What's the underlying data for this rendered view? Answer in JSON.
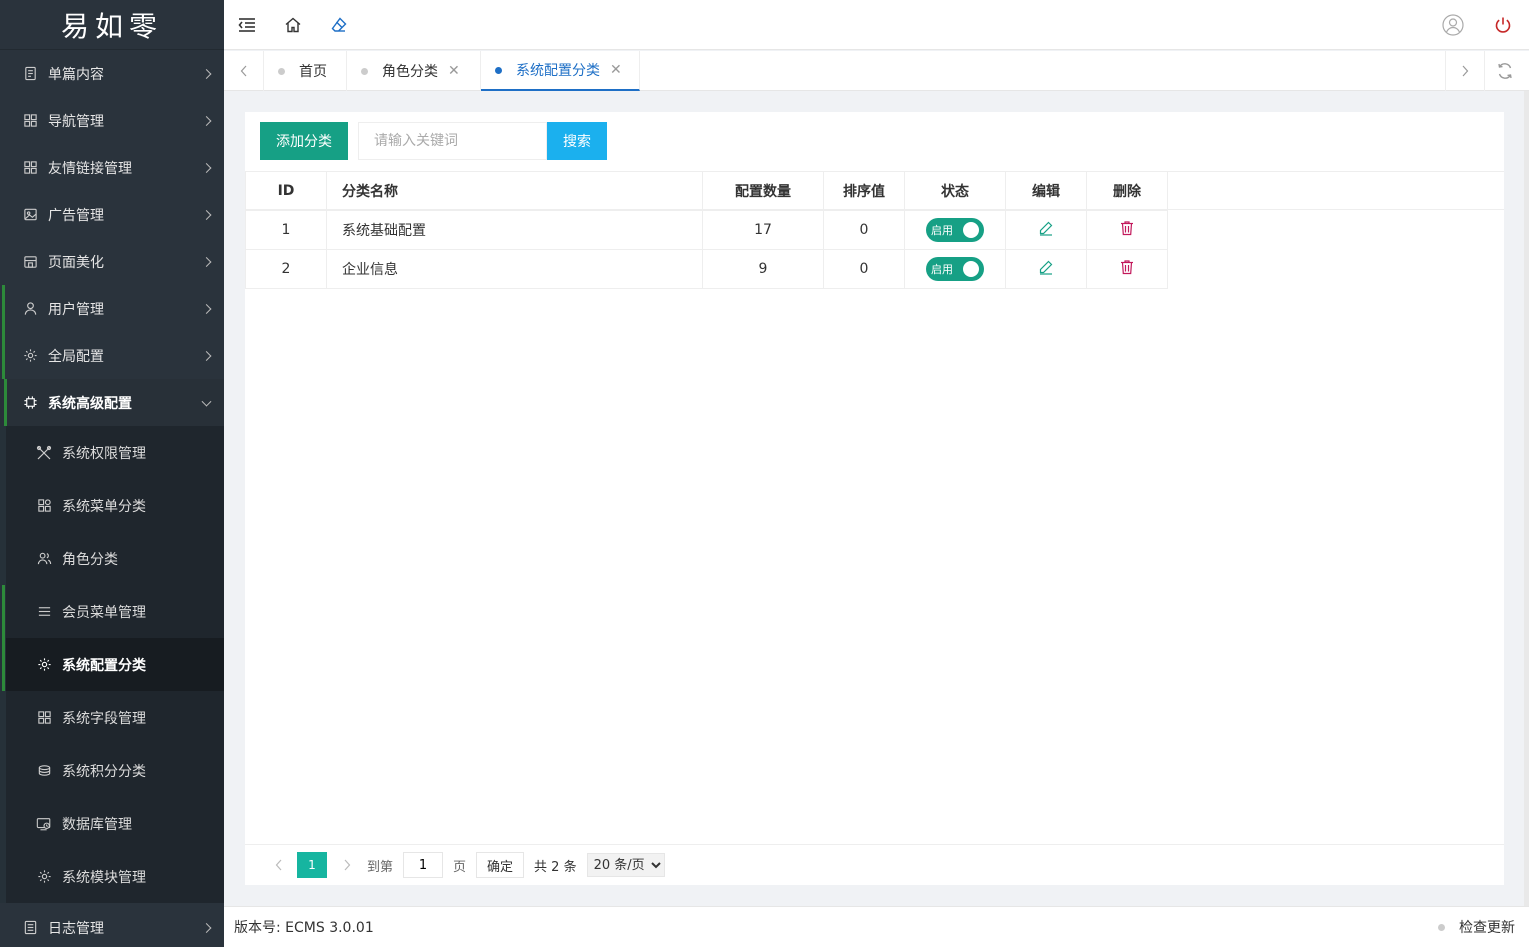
{
  "logo": "易如零",
  "sidebar": {
    "items": [
      {
        "label": "单篇内容",
        "icon": "document-icon"
      },
      {
        "label": "导航管理",
        "icon": "grid-icon"
      },
      {
        "label": "友情链接管理",
        "icon": "grid-icon"
      },
      {
        "label": "广告管理",
        "icon": "image-icon"
      },
      {
        "label": "页面美化",
        "icon": "store-icon"
      },
      {
        "label": "用户管理",
        "icon": "user-icon"
      },
      {
        "label": "全局配置",
        "icon": "gear-icon"
      },
      {
        "label": "系统高级配置",
        "icon": "chip-icon"
      }
    ],
    "submenu": [
      {
        "label": "系统权限管理",
        "icon": "tools-icon"
      },
      {
        "label": "系统菜单分类",
        "icon": "apps-icon"
      },
      {
        "label": "角色分类",
        "icon": "users-icon"
      },
      {
        "label": "会员菜单管理",
        "icon": "menu-icon"
      },
      {
        "label": "系统配置分类",
        "icon": "gear-icon"
      },
      {
        "label": "系统字段管理",
        "icon": "grid-icon"
      },
      {
        "label": "系统积分分类",
        "icon": "coins-icon"
      },
      {
        "label": "数据库管理",
        "icon": "database-icon"
      },
      {
        "label": "系统模块管理",
        "icon": "gear-icon"
      }
    ],
    "bottom": {
      "label": "日志管理",
      "icon": "log-icon"
    }
  },
  "tabs": [
    {
      "label": "首页"
    },
    {
      "label": "角色分类",
      "close": "✕"
    },
    {
      "label": "系统配置分类",
      "close": "✕"
    }
  ],
  "toolbar": {
    "add_label": "添加分类",
    "search_placeholder": "请输入关键词",
    "search_value": "",
    "search_label": "搜索"
  },
  "table": {
    "headers": [
      "ID",
      "分类名称",
      "配置数量",
      "排序值",
      "状态",
      "编辑",
      "删除"
    ],
    "rows": [
      {
        "id": "1",
        "name": "系统基础配置",
        "count": "17",
        "sort": "0",
        "status": "启用"
      },
      {
        "id": "2",
        "name": "企业信息",
        "count": "9",
        "sort": "0",
        "status": "启用"
      }
    ]
  },
  "pager": {
    "current": "1",
    "goto_label": "到第",
    "page_value": "1",
    "page_unit": "页",
    "confirm_label": "确定",
    "total_label": "共 2 条",
    "size_option": "20 条/页"
  },
  "footer": {
    "version": "版本号: ECMS 3.0.01",
    "update_label": "检查更新"
  },
  "colors": {
    "sidebar_bg": "#2a333c",
    "primary_green": "#16a085",
    "search_blue": "#1bb0ee",
    "tab_active": "#1e6fc6",
    "delete_red": "#c2185b"
  }
}
